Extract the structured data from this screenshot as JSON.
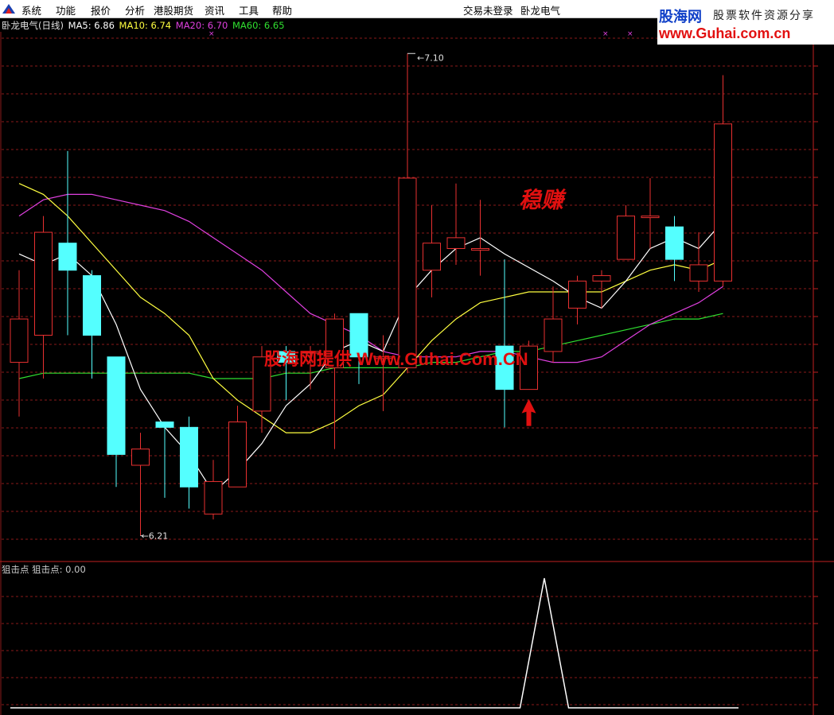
{
  "menu": {
    "items": [
      "系统",
      "功能",
      "报价",
      "分析",
      "港股期货",
      "资讯",
      "工具",
      "帮助"
    ],
    "login_status": "交易未登录",
    "stock_name": "卧龙电气"
  },
  "logo": {
    "main": "股海网",
    "slogan": "股票软件资源分享",
    "url": "www.Guhai.com.cn"
  },
  "indicators": {
    "title": "卧龙电气(日线)",
    "ma5": "MA5: 6.86",
    "ma10": "MA10: 6.74",
    "ma20": "MA20: 6.70",
    "ma60": "MA60: 6.65"
  },
  "subchart": {
    "name": "狙击点",
    "value_label": "狙击点: 0.00"
  },
  "annotations": {
    "highlight": "稳赚",
    "watermark": "股海网提供 Www.Guhai.Com.CN",
    "high_label": "7.10",
    "low_label": "6.21"
  },
  "colors": {
    "up": "#e83030",
    "down": "#54ffff",
    "ma5": "#ffffff",
    "ma10": "#ffff40",
    "ma20": "#e040e0",
    "ma60": "#30e030",
    "grid": "#8a1a1a",
    "accent": "#e01010"
  },
  "chart_data": [
    {
      "type": "candlestick",
      "title": "卧龙电气(日线)",
      "ylim": [
        6.18,
        7.14
      ],
      "candles": [
        {
          "o": 6.53,
          "h": 6.7,
          "l": 6.43,
          "c": 6.61
        },
        {
          "o": 6.58,
          "h": 6.8,
          "l": 6.5,
          "c": 6.77
        },
        {
          "o": 6.75,
          "h": 6.92,
          "l": 6.58,
          "c": 6.7
        },
        {
          "o": 6.69,
          "h": 6.7,
          "l": 6.5,
          "c": 6.58
        },
        {
          "o": 6.54,
          "h": 6.54,
          "l": 6.3,
          "c": 6.36
        },
        {
          "o": 6.34,
          "h": 6.4,
          "l": 6.21,
          "c": 6.37
        },
        {
          "o": 6.42,
          "h": 6.42,
          "l": 6.28,
          "c": 6.41
        },
        {
          "o": 6.41,
          "h": 6.43,
          "l": 6.26,
          "c": 6.3
        },
        {
          "o": 6.25,
          "h": 6.35,
          "l": 6.24,
          "c": 6.31
        },
        {
          "o": 6.3,
          "h": 6.45,
          "l": 6.3,
          "c": 6.42
        },
        {
          "o": 6.44,
          "h": 6.56,
          "l": 6.4,
          "c": 6.54
        },
        {
          "o": 6.55,
          "h": 6.56,
          "l": 6.46,
          "c": 6.53
        },
        {
          "o": 6.55,
          "h": 6.56,
          "l": 6.48,
          "c": 6.55
        },
        {
          "o": 6.52,
          "h": 6.62,
          "l": 6.37,
          "c": 6.61
        },
        {
          "o": 6.62,
          "h": 6.62,
          "l": 6.49,
          "c": 6.54
        },
        {
          "o": 6.54,
          "h": 6.58,
          "l": 6.44,
          "c": 6.54
        },
        {
          "o": 6.52,
          "h": 7.1,
          "l": 6.51,
          "c": 6.87
        },
        {
          "o": 6.7,
          "h": 6.82,
          "l": 6.65,
          "c": 6.75
        },
        {
          "o": 6.74,
          "h": 6.86,
          "l": 6.71,
          "c": 6.76
        },
        {
          "o": 6.74,
          "h": 6.83,
          "l": 6.69,
          "c": 6.74
        },
        {
          "o": 6.56,
          "h": 6.72,
          "l": 6.41,
          "c": 6.48
        },
        {
          "o": 6.48,
          "h": 6.57,
          "l": 6.48,
          "c": 6.56
        },
        {
          "o": 6.55,
          "h": 6.67,
          "l": 6.53,
          "c": 6.61
        },
        {
          "o": 6.63,
          "h": 6.69,
          "l": 6.6,
          "c": 6.68
        },
        {
          "o": 6.68,
          "h": 6.7,
          "l": 6.63,
          "c": 6.69
        },
        {
          "o": 6.72,
          "h": 6.82,
          "l": 6.72,
          "c": 6.8
        },
        {
          "o": 6.8,
          "h": 6.87,
          "l": 6.74,
          "c": 6.8
        },
        {
          "o": 6.78,
          "h": 6.8,
          "l": 6.68,
          "c": 6.72
        },
        {
          "o": 6.68,
          "h": 6.77,
          "l": 6.66,
          "c": 6.71
        },
        {
          "o": 6.68,
          "h": 7.06,
          "l": 6.67,
          "c": 6.97
        }
      ],
      "ma5": [
        6.73,
        6.71,
        6.73,
        6.69,
        6.6,
        6.48,
        6.41,
        6.36,
        6.29,
        6.33,
        6.38,
        6.45,
        6.49,
        6.55,
        6.57,
        6.55,
        6.65,
        6.7,
        6.74,
        6.76,
        6.73,
        null,
        6.68,
        6.65,
        6.63,
        6.68,
        6.74,
        6.76,
        6.74,
        6.79
      ],
      "ma10": [
        6.86,
        6.84,
        6.8,
        null,
        null,
        6.65,
        6.62,
        6.58,
        6.5,
        6.46,
        6.43,
        6.4,
        6.4,
        6.42,
        6.45,
        6.47,
        6.52,
        6.57,
        6.61,
        6.64,
        6.65,
        6.66,
        6.66,
        6.66,
        6.66,
        6.68,
        6.7,
        6.71,
        6.7,
        6.72
      ],
      "ma20": [
        6.8,
        6.83,
        6.84,
        6.84,
        6.83,
        6.82,
        6.81,
        6.79,
        6.76,
        6.73,
        6.7,
        6.66,
        6.62,
        6.6,
        6.58,
        6.55,
        6.54,
        6.54,
        6.54,
        6.55,
        6.55,
        6.54,
        6.53,
        6.53,
        6.54,
        6.57,
        6.6,
        6.62,
        6.64,
        6.67
      ],
      "ma60": [
        6.5,
        6.51,
        6.51,
        6.51,
        6.51,
        6.51,
        6.51,
        6.51,
        6.5,
        6.5,
        6.5,
        6.51,
        6.51,
        6.52,
        6.52,
        6.52,
        6.52,
        6.53,
        6.53,
        6.54,
        6.55,
        6.55,
        6.56,
        6.57,
        6.58,
        6.59,
        6.6,
        6.61,
        6.61,
        6.62
      ],
      "signal_index": 21
    },
    {
      "type": "line",
      "series": [
        {
          "name": "狙击点",
          "values": [
            0,
            0,
            0,
            0,
            0,
            0,
            0,
            0,
            0,
            0,
            0,
            0,
            0,
            0,
            0,
            0,
            0,
            0,
            0,
            0,
            0,
            0,
            1,
            0,
            0,
            0,
            0,
            0,
            0,
            0,
            0
          ]
        }
      ],
      "ylim": [
        0,
        1
      ]
    }
  ]
}
